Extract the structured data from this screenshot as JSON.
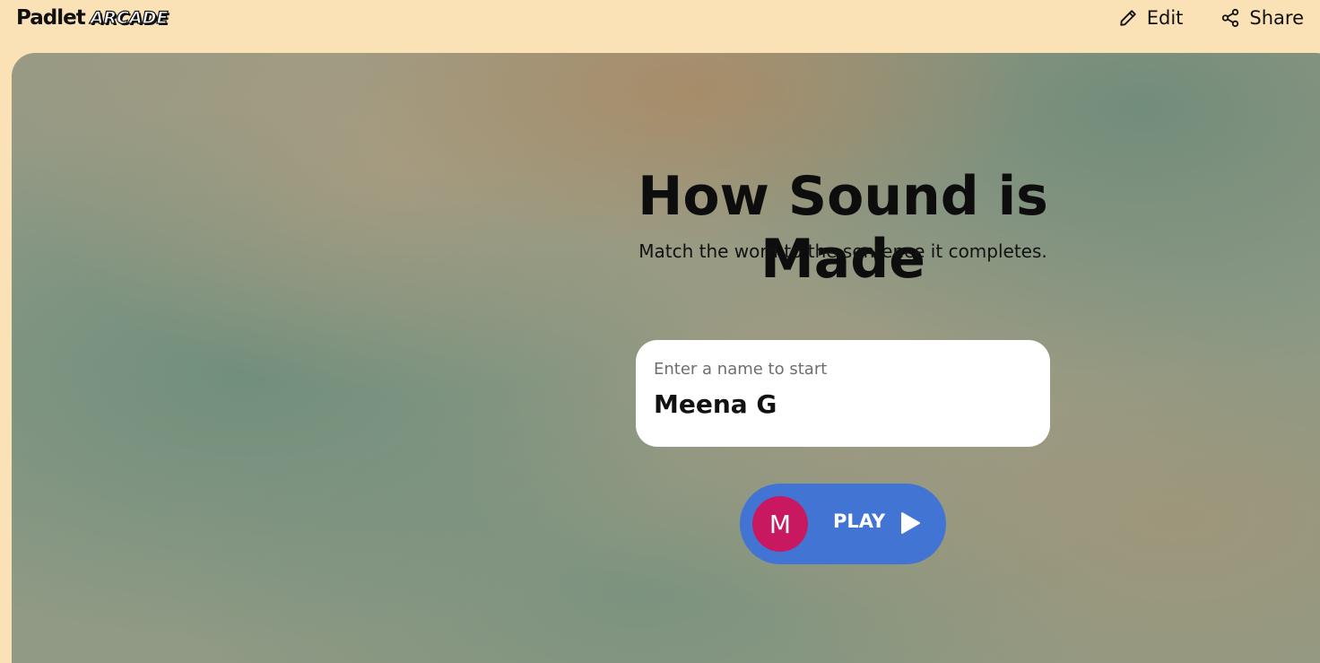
{
  "header": {
    "logo_text": "Padlet",
    "logo_badge": "ARCADE",
    "edit_label": "Edit",
    "share_label": "Share"
  },
  "game": {
    "title": "How Sound is Made",
    "subtitle": "Match the word to the sentence it completes."
  },
  "name_entry": {
    "label": "Enter a name to start",
    "value": "Meena G"
  },
  "play": {
    "avatar_initial": "M",
    "label": "PLAY",
    "icon": "play-triangle-icon"
  },
  "colors": {
    "header_background": "#fae2b6",
    "play_button": "#4274d4",
    "avatar": "#c8185f"
  }
}
